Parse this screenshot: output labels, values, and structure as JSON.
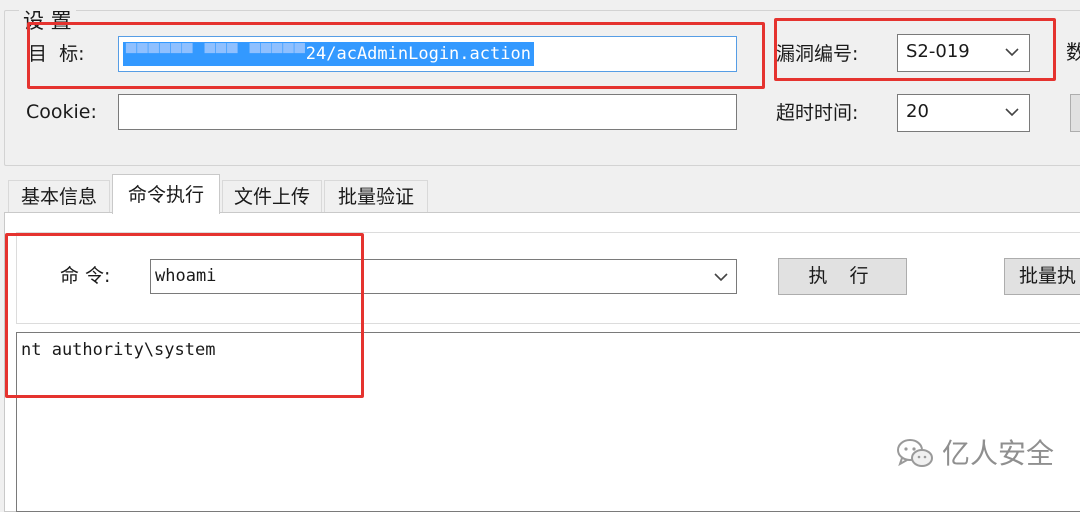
{
  "settings": {
    "group_title": "设 置",
    "target_label": "目  标:",
    "target_value_masked": "▀▀▀▀▀▀ ▀▀▀ ▀▀▀▀▀",
    "target_value_visible": "24/acAdminLogin.action",
    "cookie_label": "Cookie:",
    "cookie_value": "",
    "vuln_label": "漏洞编号:",
    "vuln_value": "S2-019",
    "timeout_label": "超时时间:",
    "timeout_value": "20",
    "cutoff_label": "数"
  },
  "tabs": [
    {
      "label": "基本信息",
      "active": false
    },
    {
      "label": "命令执行",
      "active": true
    },
    {
      "label": "文件上传",
      "active": false
    },
    {
      "label": "批量验证",
      "active": false
    }
  ],
  "command": {
    "label": "命 令:",
    "value": "whoami",
    "exec_label": "执 行",
    "batch_label": "批量执"
  },
  "output": {
    "text": "nt authority\\system"
  },
  "watermark": {
    "text": "亿人安全",
    "icon": "wechat-icon"
  },
  "colors": {
    "annotation": "#e5332f",
    "selection": "#3399ff",
    "focus_border": "#569de5"
  }
}
